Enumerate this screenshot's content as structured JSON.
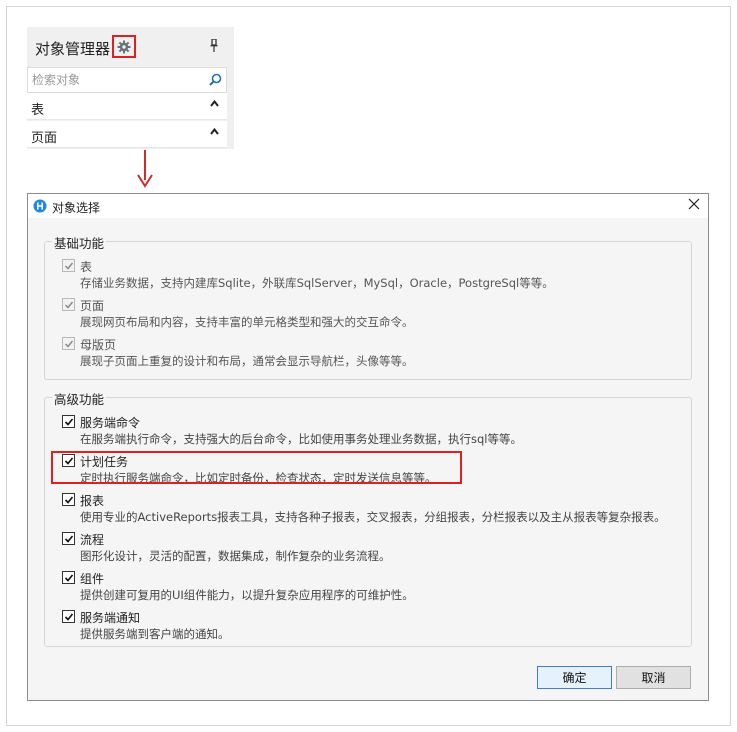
{
  "object_manager": {
    "title": "对象管理器",
    "search_placeholder": "检索对象",
    "groups": [
      {
        "label": "表"
      },
      {
        "label": "页面"
      }
    ]
  },
  "dialog": {
    "title": "对象选择",
    "basic_group": {
      "label": "基础功能",
      "items": [
        {
          "title": "表",
          "desc": "存储业务数据，支持内建库Sqlite，外联库SqlServer，MySql，Oracle，PostgreSql等等。",
          "checked": true,
          "enabled": false
        },
        {
          "title": "页面",
          "desc": "展现网页布局和内容，支持丰富的单元格类型和强大的交互命令。",
          "checked": true,
          "enabled": false
        },
        {
          "title": "母版页",
          "desc": "展现子页面上重复的设计和布局，通常会显示导航栏，头像等等。",
          "checked": true,
          "enabled": false
        }
      ]
    },
    "advanced_group": {
      "label": "高级功能",
      "items": [
        {
          "title": "服务端命令",
          "desc": "在服务端执行命令，支持强大的后台命令，比如使用事务处理业务数据，执行sql等等。",
          "checked": true
        },
        {
          "title": "计划任务",
          "desc": "定时执行服务端命令，比如定时备份，检查状态，定时发送信息等等。",
          "checked": true
        },
        {
          "title": "报表",
          "desc": "使用专业的ActiveReports报表工具，支持各种子报表，交叉报表，分组报表，分栏报表以及主从报表等复杂报表。",
          "checked": true
        },
        {
          "title": "流程",
          "desc": "图形化设计，灵活的配置，数据集成，制作复杂的业务流程。",
          "checked": true
        },
        {
          "title": "组件",
          "desc": "提供创建可复用的UI组件能力，以提升复杂应用程序的可维护性。",
          "checked": true
        },
        {
          "title": "服务端通知",
          "desc": "提供服务端到客户端的通知。",
          "checked": true
        }
      ]
    },
    "ok_label": "确定",
    "cancel_label": "取消"
  },
  "colors": {
    "highlight": "#e02020",
    "arrow": "#d42a2a",
    "app_icon": "#1e88e5"
  },
  "icons": [
    "gear-icon",
    "pin-icon",
    "search-icon",
    "chevron-up-icon",
    "arrow-down-icon",
    "app-logo-icon",
    "close-icon",
    "checkmark-icon"
  ]
}
